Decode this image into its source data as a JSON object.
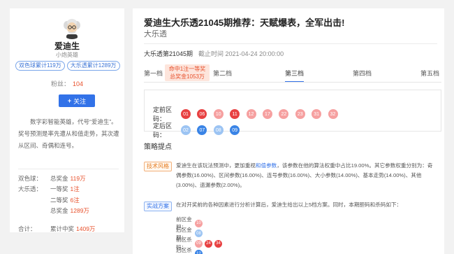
{
  "profile": {
    "name": "爱迪生",
    "rank": "小炮英雄",
    "tags": [
      "双色球累计119万",
      "大乐透累计1289万"
    ],
    "fans_label": "粉丝：",
    "fans_count": "104",
    "follow_label": "关注",
    "bio": "数字彩智能英雄，代号“爱迪生”。奖号预测是率先遭从和值走势，其次遭从区间、奇偶和连号。",
    "stats": [
      {
        "label": "双色球：",
        "name": "总奖金",
        "value": "119万"
      },
      {
        "label": "大乐透：",
        "name": "一等奖",
        "value": "1注"
      },
      {
        "label": "",
        "name": "二等奖",
        "value": "6注"
      },
      {
        "label": "",
        "name": "总奖金",
        "value": "1289万"
      }
    ],
    "total": {
      "label": "合计：",
      "name": "累计中奖",
      "value": "1409万"
    }
  },
  "article": {
    "title": "爱迪生大乐透21045期推荐：天赋爆表，全军出击!",
    "subtitle": "大乐透",
    "issue": "大乐透第21045期",
    "deadline": "截止时间 2021-04-24 20:00:00",
    "prize_badge": [
      "命中1注一等奖",
      "总奖金1053万"
    ],
    "tabs": [
      "第一档",
      "第二档",
      "第三档",
      "第四档",
      "第五档"
    ],
    "active_tab": "第三档",
    "front_label": "定前区码：",
    "back_label": "定后区码：",
    "front_balls": [
      "01",
      "06",
      "10",
      "11",
      "12",
      "17",
      "22",
      "23",
      "31",
      "32"
    ],
    "back_balls": [
      "02",
      "07",
      "08",
      "09"
    ],
    "strategy_title": "策略提点",
    "tech_tag": "技术风格",
    "tech_text_1": "爱迪生在该玩法预测中，更加重视",
    "tech_text_hl": "和值参数",
    "tech_text_2": "，该参数在他的算法权重中占比19.00%。其它参数权重分别为：奇偶参数(16.00%)、区间参数(16.00%)、连号参数(16.00%)、大小参数(14.00%)、基本走势(14.00%)、其他(3.00%)、遗漏参数(2.00%)。",
    "solution_tag": "实战方案",
    "solution_text": "在对开奖前的各种因素进行分析计算后，爱迪生给出以上5档方案。同时，本期胆码和杀码如下：",
    "solution_rows": [
      {
        "label": "前区金胆：",
        "balls": [
          "10"
        ]
      },
      {
        "label": "后区金胆：",
        "balls": [
          "08"
        ]
      },
      {
        "label": "前区杀码：",
        "balls": [
          "09",
          "24",
          "34"
        ]
      },
      {
        "label": "后区杀码：",
        "balls": [
          "12"
        ]
      }
    ]
  },
  "colors": {
    "accent_blue": "#3272e8",
    "accent_orange": "#e8502b",
    "ball_red_dark": "#e84142",
    "ball_red_light": "#f6a0a0",
    "ball_blue_dark": "#3a84e6",
    "ball_blue_light": "#9cc4f3"
  }
}
